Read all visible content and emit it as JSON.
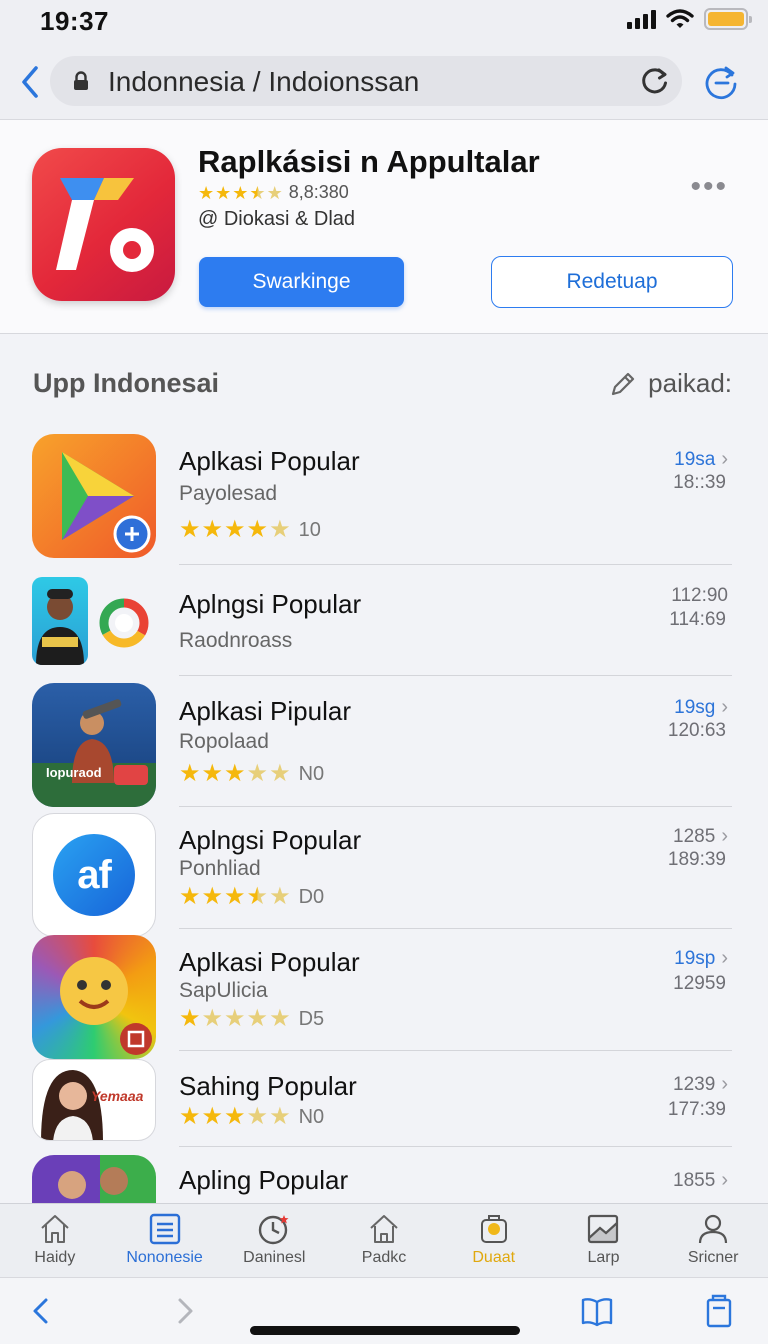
{
  "status": {
    "time": "19:37"
  },
  "address": {
    "url": "Indonnesia / Indoionssan"
  },
  "app": {
    "title": "Raplkásisi n Appultalar",
    "stars": [
      1,
      1,
      1,
      0.5,
      0
    ],
    "rating_text": "8,8:380",
    "developer": "@ Diokasi & Dlad",
    "primary_button": "Swarkinge",
    "secondary_button": "Redetuap"
  },
  "section": {
    "title": "Upp Indonesai",
    "action": "paikad:"
  },
  "list": [
    {
      "title": "Aplkasi Popular",
      "subtitle": "Payolesad",
      "stars": [
        1,
        1,
        1,
        1,
        0
      ],
      "count": "10",
      "meta1": "19sa",
      "meta1_blue": true,
      "meta2": "18::39"
    },
    {
      "title": "Aplngsi Popular",
      "subtitle": "Raodnroass",
      "stars": null,
      "count": "",
      "meta1": "112:90",
      "meta1_blue": false,
      "meta2": "114:69"
    },
    {
      "title": "Aplkasi Pipular",
      "subtitle": "Ropolaad",
      "stars": [
        1,
        1,
        1,
        0,
        0
      ],
      "count": "N0",
      "meta1": "19sg",
      "meta1_blue": true,
      "meta2": "120:63",
      "icon_label": "Iopuraod"
    },
    {
      "title": "Aplngsi Popular",
      "subtitle": "Ponhliad",
      "stars": [
        1,
        1,
        1,
        0.5,
        0
      ],
      "count": "D0",
      "meta1": "1285",
      "meta1_blue": false,
      "meta2": "189:39",
      "icon_label": "af"
    },
    {
      "title": "Aplkasi Popular",
      "subtitle": "SapUlicia",
      "stars": [
        1,
        0,
        0,
        0,
        0
      ],
      "count": "D5",
      "meta1": "19sp",
      "meta1_blue": true,
      "meta2": "12959"
    },
    {
      "title": "Sahing Popular",
      "subtitle": "",
      "stars": [
        1,
        1,
        1,
        0,
        0
      ],
      "count": "N0",
      "meta1": "1239",
      "meta1_blue": false,
      "meta2": "177:39",
      "icon_label": "Yemaaa"
    },
    {
      "title": "Apling Popular",
      "subtitle": "",
      "stars": null,
      "count": "",
      "meta1": "1855",
      "meta1_blue": false,
      "meta2": ""
    }
  ],
  "tabs": [
    {
      "label": "Haidy",
      "icon": "home-icon",
      "state": "normal"
    },
    {
      "label": "Nononesie",
      "icon": "list-icon",
      "state": "active"
    },
    {
      "label": "Daninesl",
      "icon": "clock-icon",
      "state": "normal"
    },
    {
      "label": "Padkc",
      "icon": "house-icon",
      "state": "normal"
    },
    {
      "label": "Duaat",
      "icon": "badge-icon",
      "state": "gold"
    },
    {
      "label": "Larp",
      "icon": "image-icon",
      "state": "normal"
    },
    {
      "label": "Sricner",
      "icon": "person-icon",
      "state": "normal"
    }
  ],
  "colors": {
    "accent": "#2d7cf0",
    "star": "#f5b80c",
    "gold_tab": "#e0a80e"
  }
}
